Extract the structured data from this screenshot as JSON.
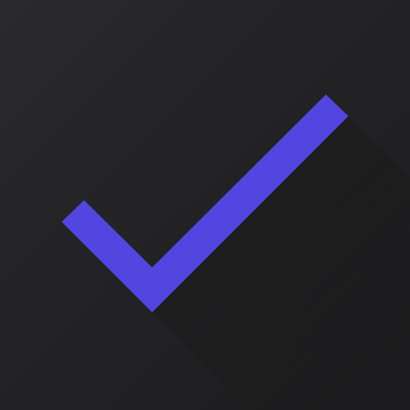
{
  "app_icon": {
    "icon": "checkmark-icon",
    "colors": {
      "background_light": "#2a2a2c",
      "background_mid": "#232325",
      "background_dark": "#1c1c1e",
      "checkmark": "#5346e0",
      "shadow": "#151516"
    }
  }
}
